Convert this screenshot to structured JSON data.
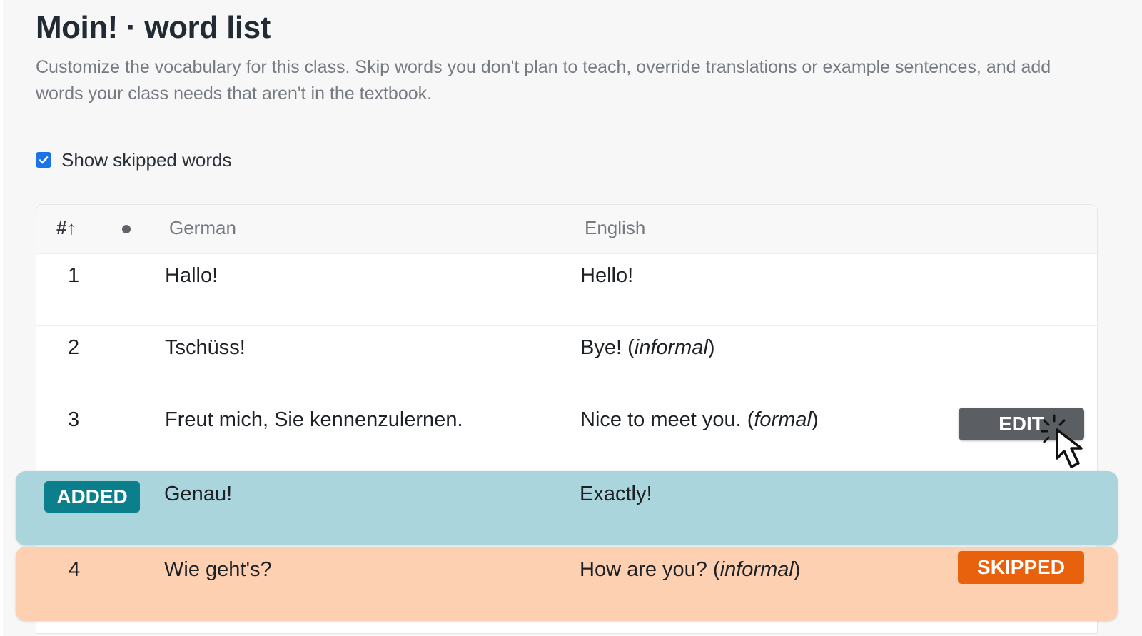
{
  "page": {
    "title": "Moin! · word list",
    "subtitle": "Customize the vocabulary for this class. Skip words you don't plan to teach, override translations or example sentences, and add words your class needs that aren't in the textbook."
  },
  "filter": {
    "show_skipped_label": "Show skipped words",
    "show_skipped_checked": true
  },
  "table": {
    "columns": {
      "number": "#↑",
      "status_icon": "dot-icon",
      "german": "German",
      "english": "English"
    },
    "rows": [
      {
        "number": "1",
        "german": "Hallo!",
        "english_main": "Hello!",
        "english_note": ""
      },
      {
        "number": "2",
        "german": "Tschüss!",
        "english_main": "Bye! (",
        "english_note": "informal",
        "english_close": ")"
      },
      {
        "number": "3",
        "german": "Freut mich, Sie kennenzulernen.",
        "english_main": "Nice to meet you. (",
        "english_note": "formal",
        "english_close": ")",
        "action_label": "EDIT"
      },
      {
        "badge": "ADDED",
        "german": "Genau!",
        "english_main": "Exactly!",
        "status": "added"
      },
      {
        "number": "4",
        "german": "Wie geht's?",
        "english_main": "How are you? (",
        "english_note": "informal",
        "english_close": ")",
        "badge": "SKIPPED",
        "status": "skipped"
      }
    ]
  },
  "colors": {
    "added_row": "#abd5dd",
    "added_badge": "#0b7f8c",
    "skipped_row": "#fdd0b1",
    "skipped_badge": "#e8620e",
    "edit_button": "#5b5e62",
    "checkbox": "#1a73e8"
  },
  "icons": {
    "checkbox": "check-icon",
    "cursor": "pointer-cursor-icon"
  }
}
